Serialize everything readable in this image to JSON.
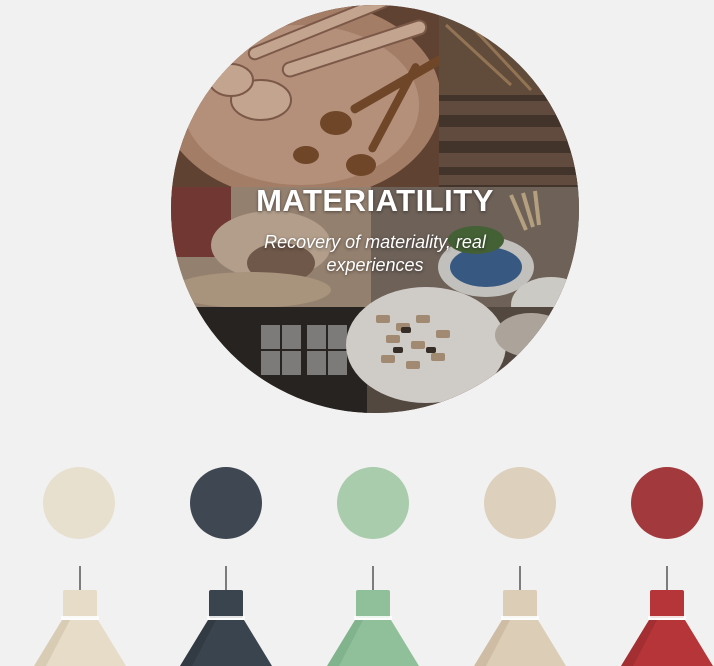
{
  "hero": {
    "title": "MATERIATILITY",
    "subtitle": "Recovery of materiality, real experiences"
  },
  "swatches": [
    {
      "name": "cream",
      "color": "#e8e0cf"
    },
    {
      "name": "slate",
      "color": "#3f4852"
    },
    {
      "name": "sage",
      "color": "#a9ccac"
    },
    {
      "name": "sand",
      "color": "#ddd0bd"
    },
    {
      "name": "red",
      "color": "#a2393c"
    }
  ],
  "lamps": [
    {
      "name": "cream",
      "color": "#e6dcc8",
      "shade": "#cdbfa6"
    },
    {
      "name": "slate",
      "color": "#3a444e",
      "shade": "#2b333b"
    },
    {
      "name": "sage",
      "color": "#8fc09a",
      "shade": "#76a884"
    },
    {
      "name": "sand",
      "color": "#dccdb6",
      "shade": "#c2b096"
    },
    {
      "name": "red",
      "color": "#b53538",
      "shade": "#952a2d"
    }
  ]
}
